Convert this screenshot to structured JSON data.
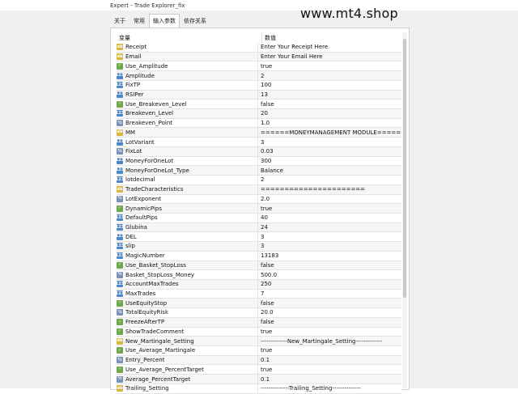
{
  "window": {
    "title": "Expert - Trade Explorer_fix"
  },
  "watermark": "www.mt4.shop",
  "tabs": [
    {
      "label": "关于"
    },
    {
      "label": "常用"
    },
    {
      "label": "输入参数"
    },
    {
      "label": "依存关系"
    }
  ],
  "active_tab": 2,
  "table": {
    "headers": {
      "name": "变量",
      "value": "数值"
    },
    "rows": [
      {
        "type": "str",
        "name": "Receipt",
        "value": "Enter Your Receipt Here"
      },
      {
        "type": "str",
        "name": "Email",
        "value": "Enter Your Email Here"
      },
      {
        "type": "bool",
        "name": "Use_Amplitude",
        "value": "true"
      },
      {
        "type": "num",
        "name": "Amplitude",
        "value": "2"
      },
      {
        "type": "num",
        "name": "FixTP",
        "value": "100"
      },
      {
        "type": "num",
        "name": "RSIPer",
        "value": "13"
      },
      {
        "type": "bool",
        "name": "Use_Breakeven_Level",
        "value": "false"
      },
      {
        "type": "num",
        "name": "Breakeven_Level",
        "value": "20"
      },
      {
        "type": "dbl",
        "name": "Breakeven_Point",
        "value": "1.0"
      },
      {
        "type": "str",
        "name": "MM",
        "value": "======MONEYMANAGEMENT MODULE======"
      },
      {
        "type": "num",
        "name": "LotVariant",
        "value": "3"
      },
      {
        "type": "dbl",
        "name": "FixLot",
        "value": "0.03"
      },
      {
        "type": "num",
        "name": "MoneyForOneLot",
        "value": "300"
      },
      {
        "type": "num",
        "name": "MoneyForOneLot_Type",
        "value": "Balance"
      },
      {
        "type": "num",
        "name": "lotdecimal",
        "value": "2"
      },
      {
        "type": "str",
        "name": "TradeCharacteristics",
        "value": "======================"
      },
      {
        "type": "dbl",
        "name": "LotExponent",
        "value": "2.0"
      },
      {
        "type": "bool",
        "name": "DynamicPips",
        "value": "true"
      },
      {
        "type": "num",
        "name": "DefaultPips",
        "value": "40"
      },
      {
        "type": "num",
        "name": "Glubina",
        "value": "24"
      },
      {
        "type": "num",
        "name": "DEL",
        "value": "3"
      },
      {
        "type": "num",
        "name": "slip",
        "value": "3"
      },
      {
        "type": "num",
        "name": "MagicNumber",
        "value": "13183"
      },
      {
        "type": "bool",
        "name": "Use_Basket_StopLoss",
        "value": "false"
      },
      {
        "type": "dbl",
        "name": "Basket_StopLoss_Money",
        "value": "500.0"
      },
      {
        "type": "num",
        "name": "AccountMaxTrades",
        "value": "250"
      },
      {
        "type": "num",
        "name": "MaxTrades",
        "value": "7"
      },
      {
        "type": "bool",
        "name": "UseEquityStop",
        "value": "false"
      },
      {
        "type": "dbl",
        "name": "TotalEquityRisk",
        "value": "20.0"
      },
      {
        "type": "bool",
        "name": "FreezeAfterTP",
        "value": "false"
      },
      {
        "type": "bool",
        "name": "ShowTradeComment",
        "value": "true"
      },
      {
        "type": "str",
        "name": "New_Martingale_Setting",
        "value": "-------------New_Martingale_Setting-------------"
      },
      {
        "type": "bool",
        "name": "Use_Average_Martingale",
        "value": "true"
      },
      {
        "type": "dbl",
        "name": "Entry_Percent",
        "value": "0.1"
      },
      {
        "type": "bool",
        "name": "Use_Average_PercentTarget",
        "value": "true"
      },
      {
        "type": "dbl",
        "name": "Average_PercentTarget",
        "value": "0.1"
      },
      {
        "type": "str",
        "name": "Trailing_Setting",
        "value": "--------------Trailing_Setting--------------"
      }
    ]
  },
  "icon_labels": {
    "str": "ab",
    "bool": "✓",
    "num": "123",
    "dbl": "½"
  }
}
